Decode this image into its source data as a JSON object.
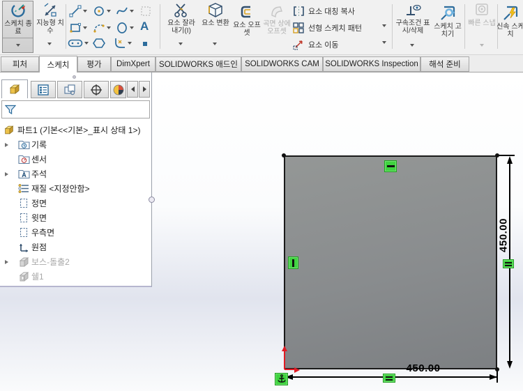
{
  "ribbon": {
    "exit_sketch": "스케치 종료",
    "smart_dimension": "지능형 치수",
    "trim_entities": "요소 잘라내기(I)",
    "convert_entities": "요소 변환",
    "offset_entities": "요소 오프셋",
    "surface_offset": "곡면 상에 오프셋",
    "mirror_entities": "요소 대칭 복사",
    "linear_pattern": "선형 스케치 패턴",
    "move_entities": "요소 이동",
    "relations": "구속조건 표시/삭제",
    "repair_sketch": "스케치 고치기",
    "quick_snaps": "빠른 스냅",
    "rapid_sketch": "신속 스케치",
    "text_tool_glyph": "A"
  },
  "tabs": {
    "items": [
      "피처",
      "스케치",
      "평가",
      "DimXpert",
      "SOLIDWORKS 애드인",
      "SOLIDWORKS CAM",
      "SOLIDWORKS Inspection",
      "해석 준비"
    ],
    "active": "스케치"
  },
  "sidebar": {
    "root_label": "파트1 (기본<<기본>_표시 상태 1>)",
    "items": [
      {
        "label": "기록"
      },
      {
        "label": "센서"
      },
      {
        "label": "주석"
      },
      {
        "label": "재질 <지정안함>"
      },
      {
        "label": "정면"
      },
      {
        "label": "윗면"
      },
      {
        "label": "우측면"
      },
      {
        "label": "원점"
      },
      {
        "label": "보스-돌출2"
      },
      {
        "label": "쉘1"
      }
    ]
  },
  "canvas": {
    "width_dim": "450.00",
    "height_dim": "450.00"
  }
}
